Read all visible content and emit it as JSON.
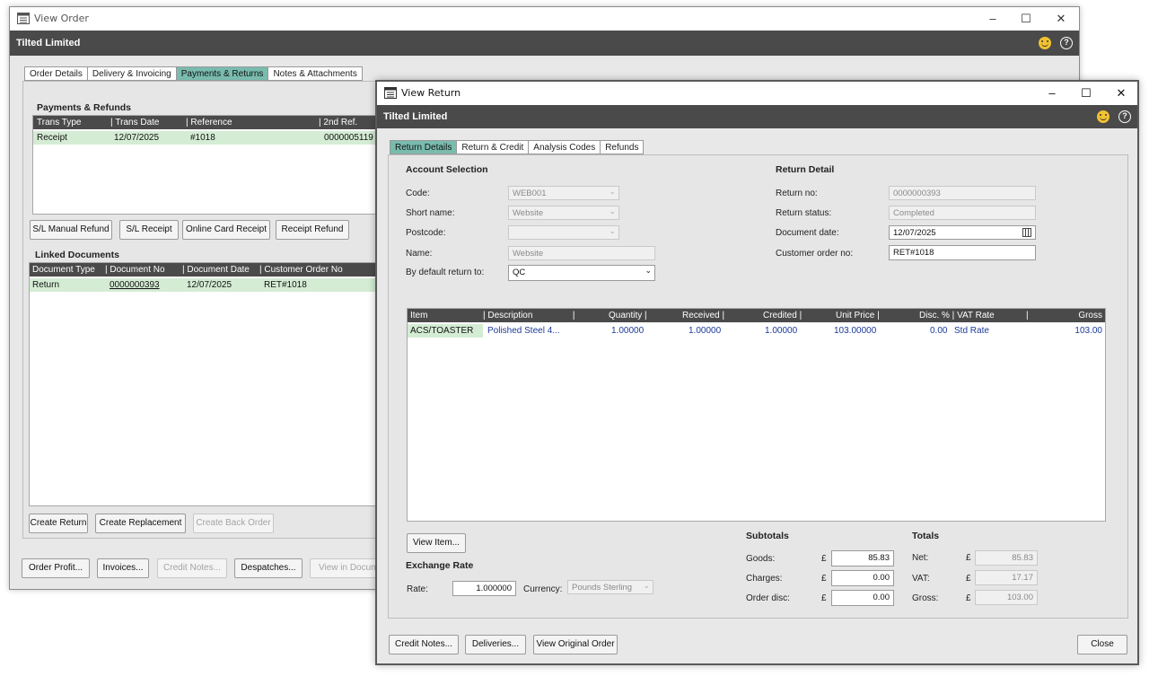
{
  "order_window": {
    "title": "View Order",
    "company": "Tilted Limited",
    "tabs": [
      "Order Details",
      "Delivery & Invoicing",
      "Payments & Returns",
      "Notes & Attachments"
    ],
    "payments": {
      "title": "Payments & Refunds",
      "columns": [
        "Trans Type",
        "Trans Date",
        "Reference",
        "2nd Ref."
      ],
      "rows": [
        [
          "Receipt",
          "12/07/2025",
          "#1018",
          "0000005119"
        ]
      ]
    },
    "payment_buttons": [
      "S/L Manual Refund",
      "S/L Receipt",
      "Online Card Receipt",
      "Receipt Refund"
    ],
    "linked": {
      "title": "Linked Documents",
      "columns": [
        "Document Type",
        "Document No",
        "Document Date",
        "Customer Order No"
      ],
      "rows": [
        [
          "Return",
          "0000000393",
          "12/07/2025",
          "RET#1018"
        ]
      ]
    },
    "linked_buttons": [
      "Create Return",
      "Create Replacement",
      "Create Back Order"
    ],
    "footer_buttons": [
      "Order Profit...",
      "Invoices...",
      "Credit Notes...",
      "Despatches...",
      "View in Docum"
    ]
  },
  "return_window": {
    "title": "View Return",
    "company": "Tilted Limited",
    "tabs": [
      "Return Details",
      "Return & Credit",
      "Analysis Codes",
      "Refunds"
    ],
    "account": {
      "title": "Account Selection",
      "code_label": "Code:",
      "code": "WEB001",
      "short_name_label": "Short name:",
      "short_name": "Website",
      "postcode_label": "Postcode:",
      "postcode": "",
      "name_label": "Name:",
      "name": "Website",
      "default_return_label": "By default return to:",
      "default_return": "QC"
    },
    "detail": {
      "title": "Return Detail",
      "return_no_label": "Return no:",
      "return_no": "0000000393",
      "status_label": "Return status:",
      "status": "Completed",
      "doc_date_label": "Document date:",
      "doc_date": "12/07/2025",
      "cust_order_label": "Customer order no:",
      "cust_order": "RET#1018"
    },
    "lines": {
      "columns": [
        "Item",
        "Description",
        "Quantity",
        "Received",
        "Credited",
        "Unit Price",
        "Disc. %",
        "VAT Rate",
        "Gross"
      ],
      "rows": [
        [
          "ACS/TOASTER",
          "Polished Steel 4...",
          "1.00000",
          "1.00000",
          "1.00000",
          "103.00000",
          "0.00",
          "Std Rate",
          "103.00"
        ]
      ]
    },
    "view_item_button": "View Item...",
    "exchange": {
      "title": "Exchange Rate",
      "rate_label": "Rate:",
      "rate": "1.000000",
      "currency_label": "Currency:",
      "currency": "Pounds Sterling"
    },
    "subtotals": {
      "title": "Subtotals",
      "currency_symbol": "£",
      "goods_label": "Goods:",
      "goods": "85.83",
      "charges_label": "Charges:",
      "charges": "0.00",
      "disc_label": "Order disc:",
      "disc": "0.00"
    },
    "totals": {
      "title": "Totals",
      "currency_symbol": "£",
      "net_label": "Net:",
      "net": "85.83",
      "vat_label": "VAT:",
      "vat": "17.17",
      "gross_label": "Gross:",
      "gross": "103.00"
    },
    "footer_buttons": [
      "Credit Notes...",
      "Deliveries...",
      "View Original Order"
    ],
    "close_button": "Close"
  },
  "window_controls": {
    "minimize": "–",
    "maximize": "☐",
    "close": "✕"
  },
  "help_glyph": "?",
  "colors": {
    "dark_bar": "#4a4a4a",
    "active_tab": "#79bcae",
    "selected_row": "#d4ecd4",
    "link_blue": "#1b3a9a"
  }
}
